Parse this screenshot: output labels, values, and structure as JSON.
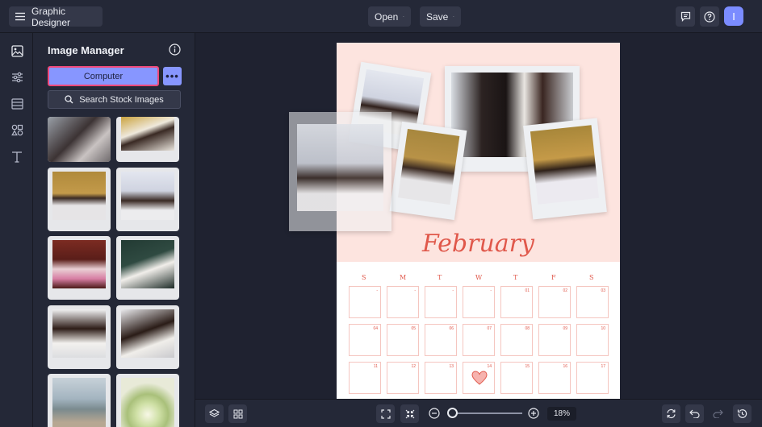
{
  "header": {
    "app_title": "Graphic Designer",
    "open_label": "Open",
    "save_label": "Save",
    "avatar_initial": "I"
  },
  "panel": {
    "title": "Image Manager",
    "computer_label": "Computer",
    "more_label": "•••",
    "search_label": "Search Stock Images"
  },
  "calendar": {
    "month": "February",
    "weekdays": [
      "S",
      "M",
      "T",
      "W",
      "T",
      "F",
      "S"
    ],
    "rows": [
      [
        "-",
        "-",
        "-",
        "-",
        "01",
        "02",
        "03"
      ],
      [
        "04",
        "05",
        "06",
        "07",
        "08",
        "09",
        "10"
      ],
      [
        "11",
        "12",
        "13",
        "14",
        "15",
        "16",
        "17"
      ]
    ]
  },
  "zoom": {
    "value_label": "18%",
    "level_percent": 18
  },
  "colors": {
    "accent": "#8796ff",
    "highlight": "#f0497a",
    "calendar_red": "#e0584b",
    "page_blush": "#fde4df"
  },
  "icons": {
    "rail": [
      "image-icon",
      "sliders-icon",
      "layout-icon",
      "shapes-icon",
      "text-icon"
    ],
    "bottom": [
      "layers-icon",
      "grid-icon",
      "fit-screen-icon",
      "shrink-icon",
      "zoom-out-icon",
      "zoom-in-icon",
      "replace-icon",
      "undo-icon",
      "redo-icon",
      "history-icon"
    ]
  }
}
